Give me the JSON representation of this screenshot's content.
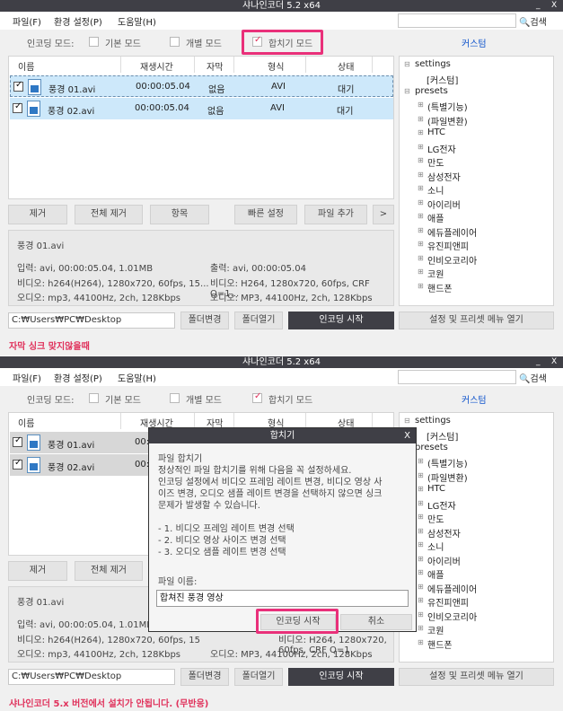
{
  "window": {
    "title": "샤나인코더  5.2  x64",
    "minimize": "_",
    "close": "X"
  },
  "menu": {
    "file": "파일(F)",
    "settings": "환경 설정(P)",
    "help": "도움말(H)",
    "search": "검색"
  },
  "modes": {
    "label": "인코딩 모드:",
    "basic": "기본 모드",
    "individual": "개별 모드",
    "merge": "합치기 모드",
    "custom": "커스텀"
  },
  "columns": [
    "이름",
    "재생시간",
    "자막",
    "형식",
    "상태"
  ],
  "rows": [
    {
      "name": "풍경 01.avi",
      "duration": "00:00:05.04",
      "subtitle": "없음",
      "format": "AVI",
      "status": "대기"
    },
    {
      "name": "풍경 02.avi",
      "duration": "00:00:05.04",
      "subtitle": "없음",
      "format": "AVI",
      "status": "대기"
    }
  ],
  "buttons": {
    "remove": "제거",
    "remove_all": "전체 제거",
    "item": "항목",
    "quick": "빠른 설정",
    "add": "파일 추가",
    "more": ">",
    "folder_change": "폴더변경",
    "folder_open": "폴더열기",
    "encode": "인코딩 시작",
    "settings_menu": "설정 및 프리셋 메뉴 열기"
  },
  "info": {
    "filename": "풍경 01.avi",
    "input_l": "입력: avi, 00:00:05.04, 1.01MB",
    "video_l": "비디오: h264(H264), 1280x720, 60fps, 15...",
    "audio_l": "오디오: mp3, 44100Hz, 2ch, 128Kbps",
    "output_r": "출력: avi, 00:00:05.04",
    "video_r": "비디오: H264, 1280x720, 60fps, CRF Q=1...",
    "audio_r": "오디오: MP3, 44100Hz, 2ch, 128Kbps"
  },
  "info2_video_l": "비디오: h264(H264), 1280x720, 60fps, 15",
  "info2_video_r": "비디오: H264, 1280x720, 60fps, CRF Q=1",
  "path": "C:₩Users₩PC₩Desktop",
  "tree": {
    "settings": "settings",
    "custom": "[커스텀]",
    "presets": "presets",
    "items": [
      "(특별기능)",
      "(파일변환)",
      "HTC",
      "LG전자",
      "만도",
      "삼성전자",
      "소니",
      "아이리버",
      "애플",
      "에듀플레이어",
      "유진피앤피",
      "인비오코리아",
      "코원",
      "핸드폰"
    ]
  },
  "captions": {
    "top": "자막 싱크 맞지않을때",
    "bottom": "샤나인코더 5.x 버전에서 설치가 안됩니다. (무반응)"
  },
  "dialog": {
    "title": "합치기",
    "close": "X",
    "lines": [
      "파일 합치기",
      "정상적인 파일 합치기를 위해 다음을 꼭 설정하세요.",
      "인코딩 설정에서 비디오 프레임 레이트 변경, 비디오 영상 사",
      "이즈 변경, 오디오 샘플 레이트 변경을 선택하지 않으면 싱크",
      "문제가 발생할 수 있습니다.",
      "",
      "- 1. 비디오 프레임 레이트 변경 선택",
      "- 2. 비디오 영상 사이즈 변경 선택",
      "- 3. 오디오 샘플 레이트 변경 선택"
    ],
    "filename_label": "파일 이름:",
    "filename_value": "합쳐진 풍경 영상",
    "encode": "인코딩 시작",
    "cancel": "취소"
  },
  "colors": {
    "highlight": "#e9307a",
    "title_bar": "#3f3f46",
    "row_selected": "#cde8fa",
    "link": "#1155cc"
  }
}
